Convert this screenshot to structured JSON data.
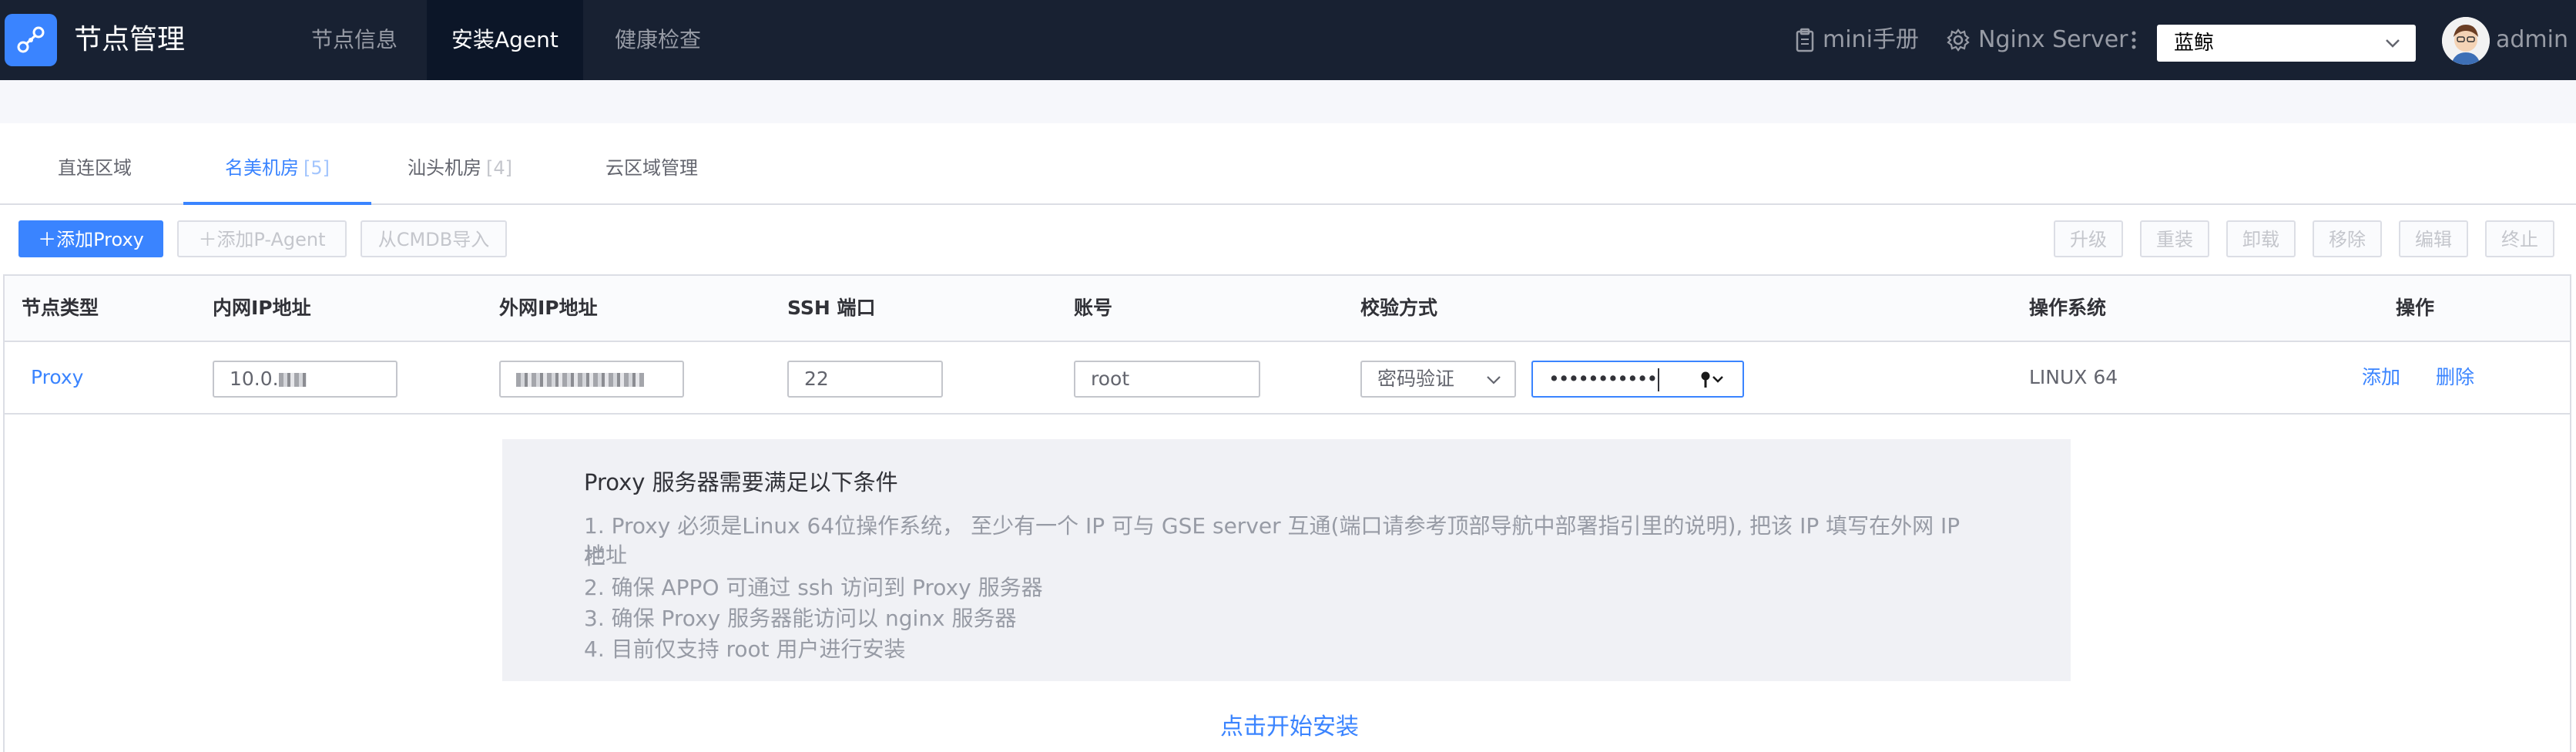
{
  "header": {
    "app_title": "节点管理",
    "nav": [
      {
        "label": "节点信息"
      },
      {
        "label": "安装Agent"
      },
      {
        "label": "健康检查"
      }
    ],
    "manual_label": "mini手册",
    "server_label": "Nginx Server",
    "business_select": "蓝鲸",
    "user": "admin"
  },
  "tabs": [
    {
      "label": "直连区域",
      "count": ""
    },
    {
      "label": "名美机房",
      "count": "[5]"
    },
    {
      "label": "汕头机房",
      "count": "[4]"
    },
    {
      "label": "云区域管理",
      "count": ""
    }
  ],
  "toolbar": {
    "add_proxy": "添加Proxy",
    "add_pagent": "添加P-Agent",
    "import_cmdb": "从CMDB导入",
    "actions": [
      "升级",
      "重装",
      "卸载",
      "移除",
      "编辑",
      "终止"
    ]
  },
  "table": {
    "headers": [
      "节点类型",
      "内网IP地址",
      "外网IP地址",
      "SSH 端口",
      "账号",
      "校验方式",
      "操作系统",
      "操作"
    ],
    "row": {
      "node_type": "Proxy",
      "inner_ip": "10.0.",
      "ssh_port": "22",
      "account": "root",
      "auth_method": "密码验证",
      "password_mask": "•••••••••••",
      "os": "LINUX 64",
      "action_add": "添加",
      "action_delete": "删除"
    }
  },
  "info": {
    "title": "Proxy 服务器需要满足以下条件",
    "lines": [
      "1. Proxy 必须是Linux 64位操作系统， 至少有一个 IP 可与 GSE server 互通(端口请参考顶部导航中部署指引里的说明), 把该 IP 填写在外网 IP 地址",
      "栏",
      "2. 确保 APPO 可通过 ssh 访问到 Proxy 服务器",
      "3. 确保 Proxy 服务器能访问以 nginx 服务器",
      "4. 目前仅支持 root 用户进行安装"
    ]
  },
  "start_install": "点击开始安装",
  "colors": {
    "topbar": "#182132",
    "accent": "#3a84ff",
    "info_bg": "#f0f1f5"
  }
}
